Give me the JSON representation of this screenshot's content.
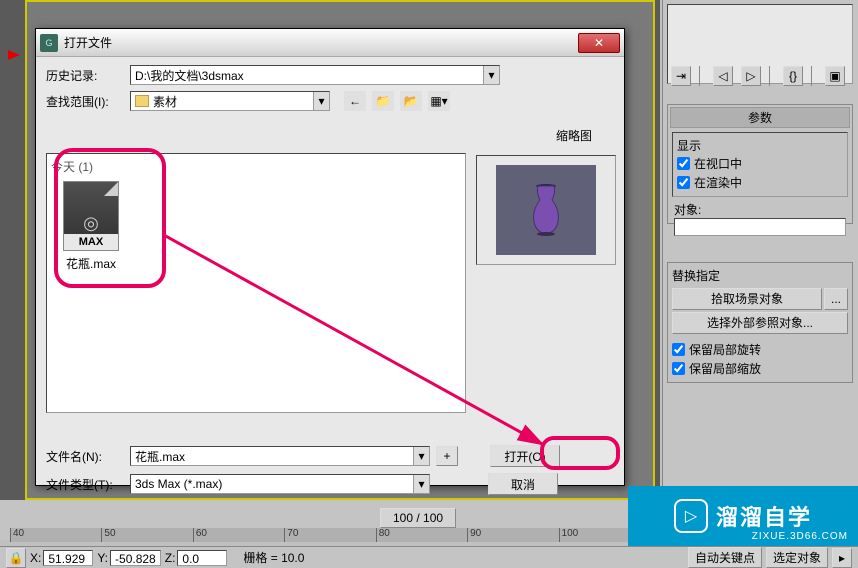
{
  "dialog": {
    "title": "打开文件",
    "history_label": "历史记录:",
    "history_value": "D:\\我的文档\\3dsmax",
    "lookin_label": "查找范围(I):",
    "lookin_value": "素材",
    "thumb_label": "缩略图",
    "section_today": "今天 (1)",
    "file_name": "花瓶.max",
    "file_ext_label": "MAX",
    "filename_label": "文件名(N):",
    "filename_value": "花瓶.max",
    "filetype_label": "文件类型(T):",
    "filetype_value": "3ds Max (*.max)",
    "plus": "+",
    "open_btn": "打开(O)",
    "cancel_btn": "取消"
  },
  "rightpanel": {
    "params_header": "参数",
    "display_group": "显示",
    "cb_viewport": "在视口中",
    "cb_render": "在渲染中",
    "object_label": "对象:",
    "assign_group": "替换指定",
    "btn_pick": "拾取场景对象",
    "btn_extern": "选择外部参照对象...",
    "cb_rotate": "保留局部旋转",
    "cb_scale": "保留局部缩放"
  },
  "timeline": {
    "slider": "100 / 100",
    "ticks": [
      "40",
      "50",
      "60",
      "70",
      "80",
      "90",
      "100"
    ]
  },
  "status": {
    "x_label": "X:",
    "x_val": "51.929",
    "y_label": "Y:",
    "y_val": "-50.828",
    "z_label": "Z:",
    "z_val": "0.0",
    "grid_label": "栅格 = 10.0",
    "autokey": "自动关键点",
    "selobj": "选定对象"
  },
  "watermark": {
    "text": "溜溜自学",
    "sub": "ZIXUE.3D66.COM",
    "play": "▷"
  }
}
